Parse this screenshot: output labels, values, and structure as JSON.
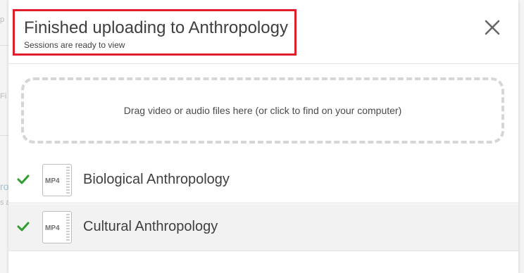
{
  "dialog": {
    "title": "Finished uploading to Anthropology",
    "subtitle": "Sessions are ready to view",
    "close_icon": "close-icon"
  },
  "dropzone": {
    "text": "Drag video or audio files here (or click to find on your computer)"
  },
  "files": [
    {
      "name": "Biological Anthropology",
      "type": "MP4",
      "status": "uploaded",
      "status_icon": "checkmark-icon"
    },
    {
      "name": "Cultural Anthropology",
      "type": "MP4",
      "status": "uploaded",
      "status_icon": "checkmark-icon"
    }
  ],
  "colors": {
    "highlight_border": "#e01e2b",
    "success": "#2e9e2e",
    "text": "#3f3f3f",
    "dropzone_border": "#d6d6d6"
  }
}
